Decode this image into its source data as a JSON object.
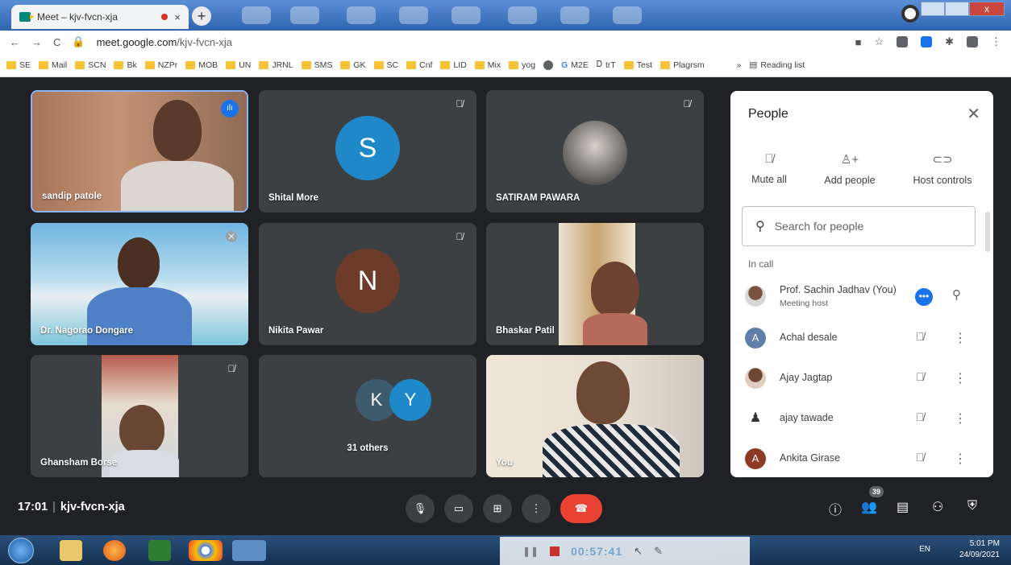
{
  "browser": {
    "tab_title": "Meet – kjv-fvcn-xja",
    "tab_close": "×",
    "new_tab": "+",
    "url_host": "meet.google.com",
    "url_path": "/kjv-fvcn-xja",
    "bookmarks": [
      "SE",
      "Mail",
      "SCN",
      "Bk",
      "NZPr",
      "MOB",
      "UN",
      "JRNL",
      "SMS",
      "GK",
      "SC",
      "Cnf",
      "LID",
      "Mix",
      "yog",
      "M2E",
      "trT",
      "Test",
      "Plagrsm"
    ],
    "overflow": "»",
    "reading_list": "Reading list"
  },
  "tiles": [
    {
      "name": "sandip patole"
    },
    {
      "name": "Shital More",
      "initial": "S",
      "color": "#1e88c8"
    },
    {
      "name": "SATIRAM PAWARA"
    },
    {
      "name": "Dr. Nagorao Dongare"
    },
    {
      "name": "Nikita Pawar",
      "initial": "N",
      "color": "#6d3b2a"
    },
    {
      "name": "Bhaskar Patil"
    },
    {
      "name": "Ghansham Borse"
    },
    {
      "name": "31 others",
      "initial_a": "K",
      "initial_b": "Y"
    },
    {
      "name": "You"
    }
  ],
  "people_panel": {
    "title": "People",
    "close": "✕",
    "mute_all": "Mute all",
    "add_people": "Add people",
    "host_controls": "Host controls",
    "search_placeholder": "Search for people",
    "section": "In call",
    "members": [
      {
        "name": "Prof. Sachin Jadhav (You)",
        "sub": "Meeting host",
        "avatar": "photo"
      },
      {
        "name": "Achal desale",
        "initial": "A",
        "color": "#5f7ea8"
      },
      {
        "name": "Ajay Jagtap",
        "avatar": "photo"
      },
      {
        "name": "ajay tawade",
        "avatar": "figure"
      },
      {
        "name": "Ankita Girase",
        "initial": "A",
        "color": "#8e3a26"
      }
    ]
  },
  "bottom_bar": {
    "time": "17:01",
    "separator": "|",
    "meeting_code": "kjv-fvcn-xja",
    "participant_count": "39"
  },
  "taskbar": {
    "lang": "EN",
    "clock_time": "5:01 PM",
    "clock_date": "24/09/2021",
    "recorder_time": "00:57:41"
  }
}
